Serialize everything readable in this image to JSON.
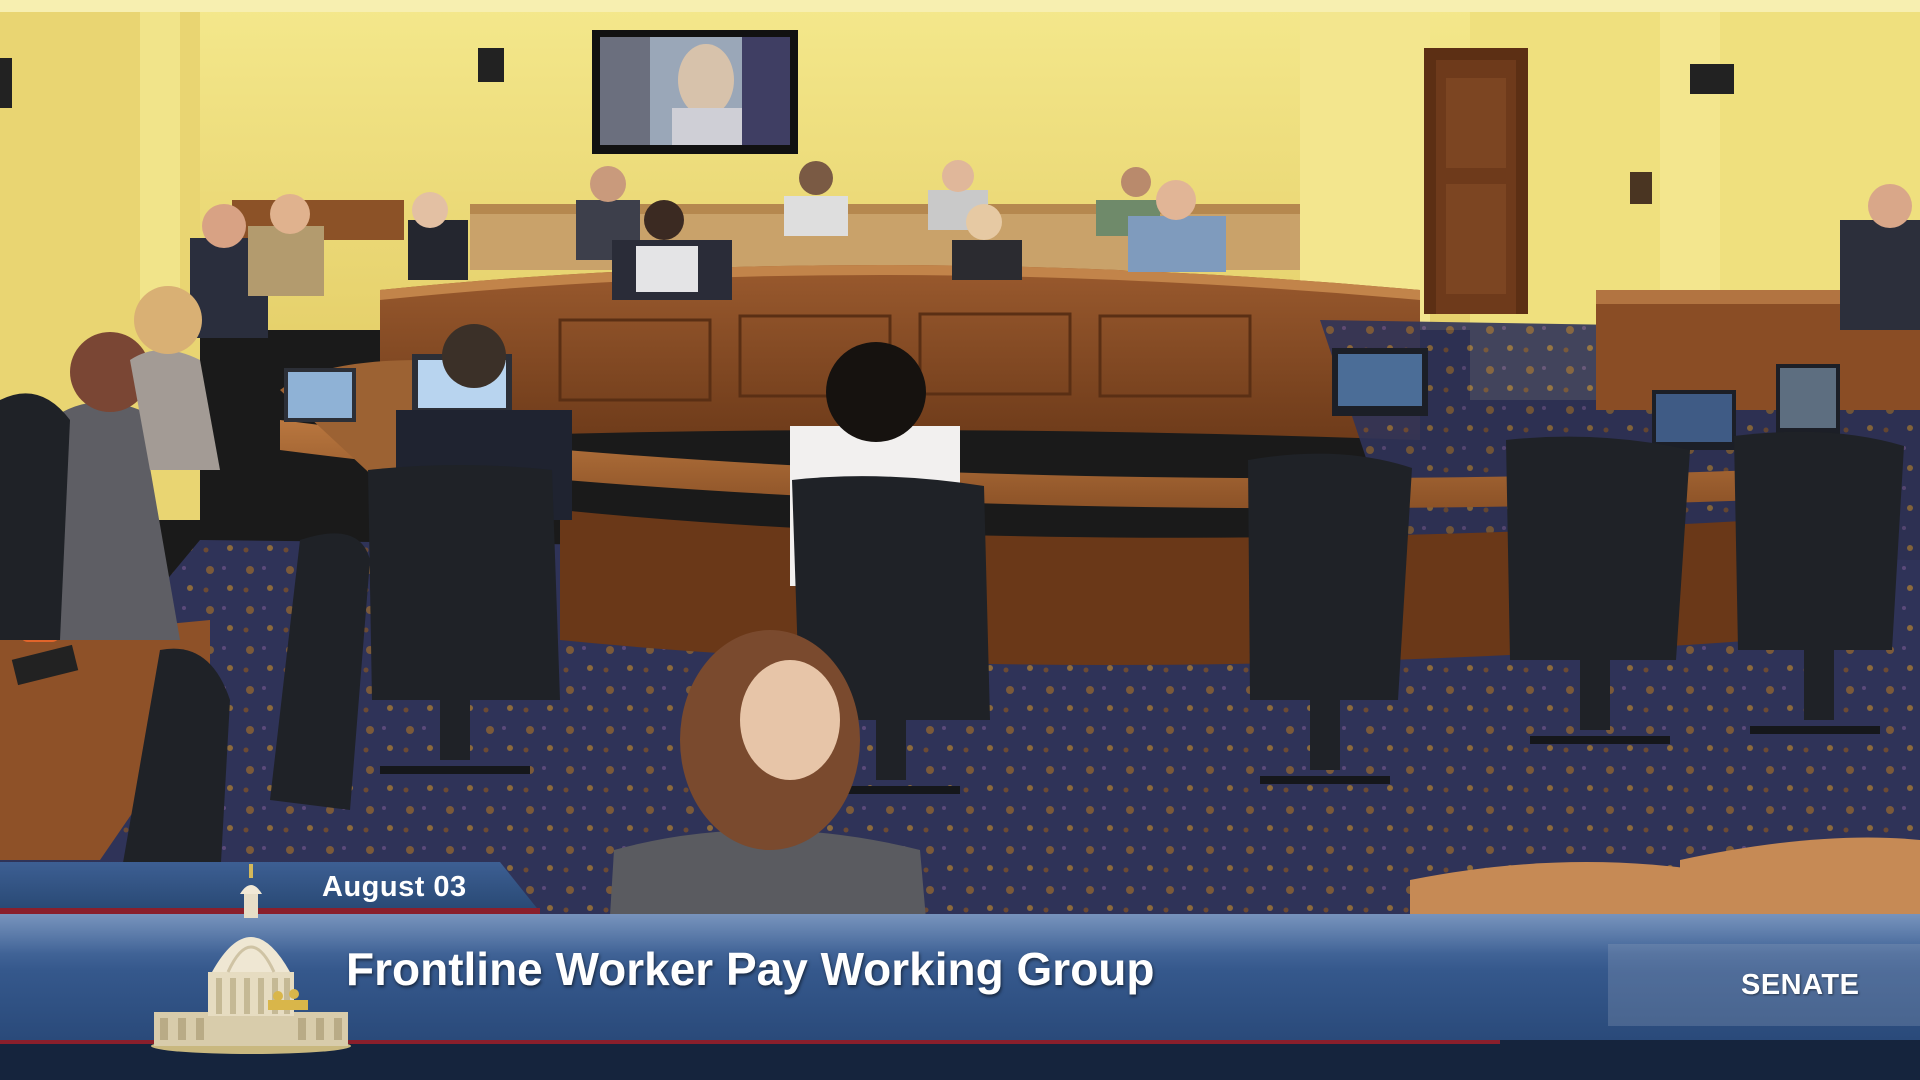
{
  "broadcast": {
    "date": "August 03",
    "title": "Frontline Worker Pay Working Group",
    "chamber": "SENATE"
  },
  "scene": {
    "icons": [
      "capitol-dome-logo"
    ],
    "colors": {
      "wall": "#efe07e",
      "wood": "#8a4d25",
      "carpet": "#2f3358",
      "banner": "#35588c",
      "accent_red": "#8a1f2c"
    }
  }
}
